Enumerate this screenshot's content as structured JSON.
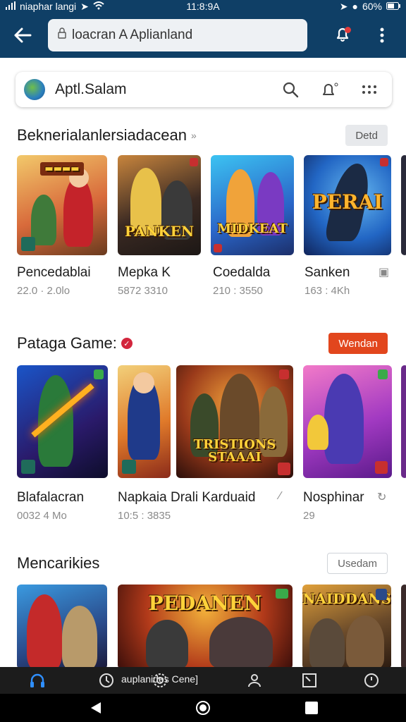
{
  "status": {
    "left_text": "niaphar langi",
    "time": "11:8:9A",
    "battery": "60%"
  },
  "appbar": {
    "url_text": "loacran A Aplianland"
  },
  "search": {
    "title": "Aptl.Salam"
  },
  "sections": [
    {
      "title": "Beknerialanlersiadacean",
      "suffix": "»",
      "action": "Detd",
      "items": [
        {
          "name": "Pencedablai",
          "meta": "22.0 · 2.0lo",
          "art": ""
        },
        {
          "name": "Mepka K",
          "meta": "5872 3310",
          "art": "PANKEN"
        },
        {
          "name": "Coedalda",
          "meta": "210 : 3550",
          "art": "MIDKEAT"
        },
        {
          "name": "Sanken",
          "meta": "163 : 4Kh",
          "art": "PERAI"
        }
      ]
    },
    {
      "title": "Pataga Game:",
      "action": "Wendan",
      "items": [
        {
          "name": "Blafalacran",
          "meta": "0032 4 Mo",
          "art": ""
        },
        {
          "name": "Napkaia Drali Karduaid",
          "meta": "10:5 : 3835",
          "art": ""
        },
        {
          "name": "",
          "meta": "",
          "art": "TRISTIONS STAAAI"
        },
        {
          "name": "Nosphinar",
          "meta": "29",
          "art": ""
        }
      ]
    },
    {
      "title": "Mencarikies",
      "action": "Usedam",
      "items": [
        {
          "art": ""
        },
        {
          "art": "PEDANEN"
        },
        {
          "art": "NAIDDANS"
        }
      ]
    }
  ],
  "bottom_nav": {
    "label": "auplanides Cene]"
  },
  "colors": {
    "appbar": "#0f3f66",
    "accent_red": "#e2461d",
    "nav_active": "#2f8fff"
  }
}
